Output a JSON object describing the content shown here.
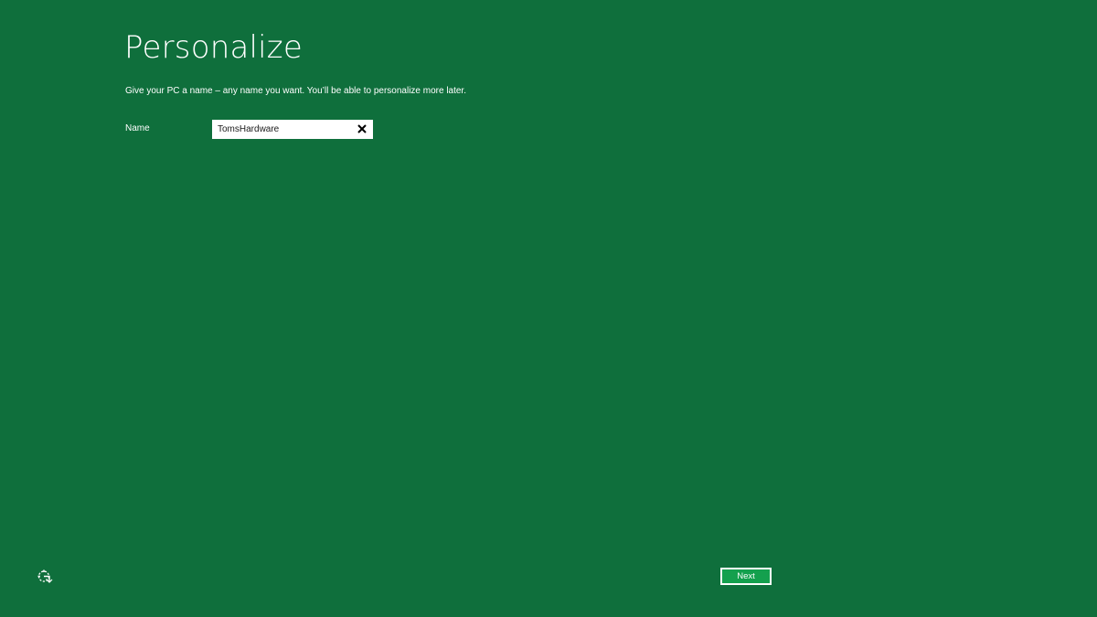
{
  "page": {
    "title": "Personalize",
    "subtitle": "Give your PC a name – any name you want. You’ll be able to personalize more later.",
    "background_color": "#0f6f3c"
  },
  "name_field": {
    "label": "Name",
    "value": "TomsHardware",
    "clear_icon": "close-icon"
  },
  "footer": {
    "next_label": "Next",
    "next_button_color": "#14a04e",
    "accessibility_icon": "ease-of-access-icon"
  }
}
